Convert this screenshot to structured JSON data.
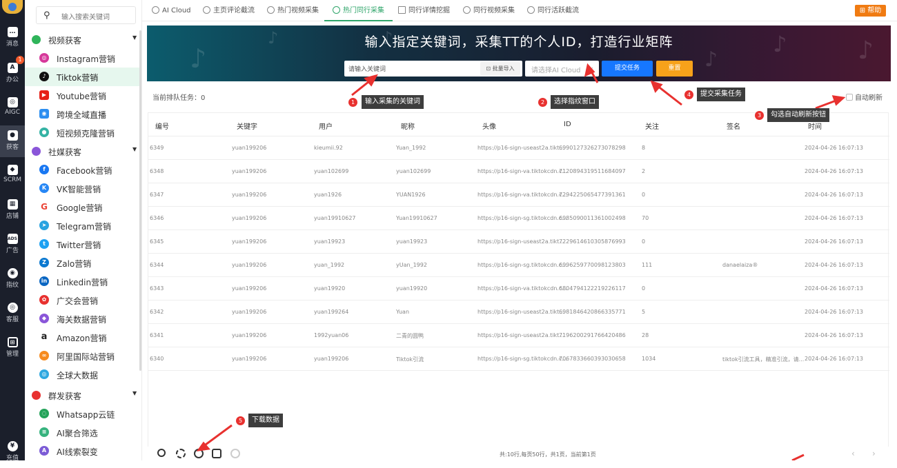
{
  "rail": [
    {
      "label": "消息",
      "icon": "chat-icon"
    },
    {
      "label": "办公",
      "icon": "office-icon",
      "badge": "1"
    },
    {
      "label": "AIGC",
      "icon": "aigc-icon"
    },
    {
      "label": "获客",
      "icon": "user-icon"
    },
    {
      "label": "SCRM",
      "icon": "scrm-icon"
    },
    {
      "label": "店铺",
      "icon": "store-icon"
    },
    {
      "label": "广告",
      "icon": "ads-icon"
    },
    {
      "label": "指纹",
      "icon": "fingerprint-icon"
    },
    {
      "label": "客服",
      "icon": "service-icon"
    },
    {
      "label": "管理",
      "icon": "grid-icon"
    },
    {
      "label": "充值",
      "icon": "recharge-icon"
    }
  ],
  "sidebar": {
    "search_placeholder": "输入搜索关键词",
    "groups": [
      {
        "label": "视频获客",
        "color": "#2fb45a",
        "items": [
          {
            "label": "Instagram营销",
            "color": "#d6389a"
          },
          {
            "label": "Tiktok营销",
            "color": "#111111",
            "active": true
          },
          {
            "label": "Youtube营销",
            "color": "#e62117"
          },
          {
            "label": "跨境全域直播",
            "color": "#2b8ef0"
          },
          {
            "label": "短视频克隆营销",
            "color": "#35b3a4"
          }
        ]
      },
      {
        "label": "社媒获客",
        "color": "#8a56d9",
        "items": [
          {
            "label": "Facebook营销",
            "color": "#1877f2"
          },
          {
            "label": "VK智能营销",
            "color": "#2787f5"
          },
          {
            "label": "Google营销",
            "color": "#ea4335"
          },
          {
            "label": "Telegram营销",
            "color": "#2aa3e0"
          },
          {
            "label": "Twitter营销",
            "color": "#1da1f2"
          },
          {
            "label": "Zalo营销",
            "color": "#0a78d0"
          },
          {
            "label": "Linkedin营销",
            "color": "#0a66c2"
          },
          {
            "label": "广交会营销",
            "color": "#e8312f"
          },
          {
            "label": "海关数据营销",
            "color": "#8a56d9"
          },
          {
            "label": "Amazon营销",
            "color": "#222222"
          },
          {
            "label": "阿里国际站营销",
            "color": "#f68b1f"
          },
          {
            "label": "全球大数据",
            "color": "#2fa8e0"
          }
        ]
      },
      {
        "label": "群发获客",
        "color": "#e8312f",
        "items": [
          {
            "label": "Whatsapp云链",
            "color": "#25a35a"
          },
          {
            "label": "AI聚合筛选",
            "color": "#36b37e"
          },
          {
            "label": "AI线索裂变",
            "color": "#7c5cd6"
          }
        ]
      }
    ]
  },
  "tabs": [
    {
      "label": "AI Cloud"
    },
    {
      "label": "主页评论截流"
    },
    {
      "label": "热门视频采集"
    },
    {
      "label": "热门同行采集",
      "active": true
    },
    {
      "label": "同行详情挖掘"
    },
    {
      "label": "同行视频采集"
    },
    {
      "label": "同行活跃截流"
    }
  ],
  "help_label": "帮助",
  "banner": {
    "title": "输入指定关键词，采集TT的个人ID，打造行业矩阵",
    "keyword_placeholder": "请输入关键词",
    "batch_import": "批量导入",
    "select_placeholder": "请选择AI Cloud",
    "submit_label": "提交任务",
    "reset_label": "重置"
  },
  "queue_label": "当前排队任务：0",
  "auto_refresh_label": "自动刷新",
  "table": {
    "headers": [
      "编号",
      "关键字",
      "用户",
      "昵称",
      "头像",
      "ID",
      "关注",
      "签名",
      "时间"
    ],
    "rows": [
      [
        "6349",
        "yuan199206",
        "kieumii.92",
        "Yuan_1992",
        "https://p16-sign-useast2a.tikt...",
        "6990127326273078298",
        "8",
        "",
        "2024-04-26 16:07:13"
      ],
      [
        "6348",
        "yuan199206",
        "yuan102699",
        "yuan102699",
        "https://p16-sign-va.tiktokcdn.c...",
        "7120894319511684097",
        "2",
        "",
        "2024-04-26 16:07:13"
      ],
      [
        "6347",
        "yuan199206",
        "yuan1926",
        "YUAN1926",
        "https://p16-sign-va.tiktokcdn.c...",
        "7294225065477391361",
        "0",
        "",
        "2024-04-26 16:07:13"
      ],
      [
        "6346",
        "yuan199206",
        "yuan19910627",
        "Yuan19910627",
        "https://p16-sign-sg.tiktokcdn.c...",
        "6985090011361002498",
        "70",
        "",
        "2024-04-26 16:07:13"
      ],
      [
        "6345",
        "yuan199206",
        "yuan19923",
        "yuan19923",
        "https://p16-sign-useast2a.tikt...",
        "7229614610305876993",
        "0",
        "",
        "2024-04-26 16:07:13"
      ],
      [
        "6344",
        "yuan199206",
        "yuan_1992",
        "yUan_1992",
        "https://p16-sign-sg.tiktokcdn.c...",
        "6996259770098123803",
        "111",
        "danaelaiza®",
        "2024-04-26 16:07:13"
      ],
      [
        "6343",
        "yuan199206",
        "yuan19920",
        "yuan19920",
        "https://p16-sign-va.tiktokcdn.c...",
        "6804794122219226117",
        "0",
        "",
        "2024-04-26 16:07:13"
      ],
      [
        "6342",
        "yuan199206",
        "yuan199264",
        "Yuan",
        "https://p16-sign-useast2a.tikt...",
        "6981846420866335771",
        "5",
        "",
        "2024-04-26 16:07:13"
      ],
      [
        "6341",
        "yuan199206",
        "1992yuan06",
        "二青的圆鸭",
        "https://p16-sign-useast2a.tikt...",
        "7196200291766420486",
        "28",
        "",
        "2024-04-26 16:07:13"
      ],
      [
        "6340",
        "yuan199206",
        "yuan199206",
        "Tiktok引流",
        "https://p16-sign-sg.tiktokcdn.c...",
        "7067833660393030658",
        "1034",
        "tiktok引流工具，精准引流，请...",
        "2024-04-26 16:07:13"
      ]
    ]
  },
  "pager_text": "共:10行,每页50行，共1页，当前第1页",
  "annotations": [
    {
      "num": "1",
      "text": "输入采集的关键词"
    },
    {
      "num": "2",
      "text": "选择指纹窗口"
    },
    {
      "num": "3",
      "text": "勾选自动刷新按钮"
    },
    {
      "num": "4",
      "text": "提交采集任务"
    },
    {
      "num": "5",
      "text": "下载数据"
    }
  ]
}
